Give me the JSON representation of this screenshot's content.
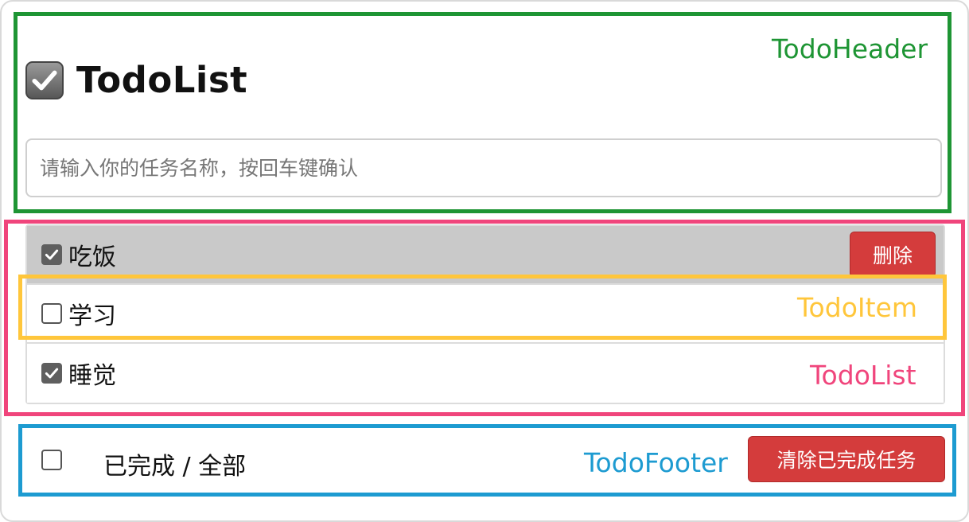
{
  "labels": {
    "header": "TodoHeader",
    "item": "TodoItem",
    "list": "TodoList",
    "footer": "TodoFooter"
  },
  "header": {
    "title": "TodoList",
    "icon": "checkbox-icon",
    "input_placeholder": "请输入你的任务名称，按回车键确认"
  },
  "todos": [
    {
      "name": "吃饭",
      "done": true
    },
    {
      "name": "学习",
      "done": false
    },
    {
      "name": "睡觉",
      "done": true
    }
  ],
  "delete_label": "删除",
  "footer": {
    "summary": "已完成 / 全部",
    "clear_label": "清除已完成任务"
  },
  "colors": {
    "header_box": "#1e9534",
    "list_box": "#f0457c",
    "item_box": "#ffc63b",
    "footer_box": "#1d9bd1",
    "danger": "#d43c3c"
  }
}
